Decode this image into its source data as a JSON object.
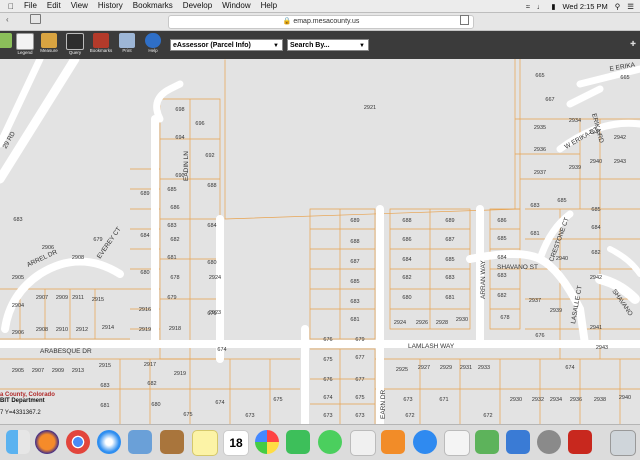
{
  "menubar": {
    "items": [
      "File",
      "Edit",
      "View",
      "History",
      "Bookmarks",
      "Develop",
      "Window",
      "Help"
    ],
    "time": "Wed 2:15 PM"
  },
  "browser": {
    "url": "emap.mesacounty.us"
  },
  "app": {
    "tools": [
      {
        "label": "Legend",
        "icon": "legend-icon"
      },
      {
        "label": "Measure",
        "icon": "measure-icon"
      },
      {
        "label": "Query",
        "icon": "query-icon"
      },
      {
        "label": "Bookmarks",
        "icon": "bookmarks-icon"
      },
      {
        "label": "Print",
        "icon": "print-icon"
      },
      {
        "label": "Help",
        "icon": "help-icon"
      }
    ],
    "layer_select": "eAssessor (Parcel Info)",
    "search_select": "Search By..."
  },
  "map": {
    "streets": [
      "W ERIKA CT",
      "ERIKA RD",
      "E ERIKA",
      "EADIN LN",
      "ARREL DR",
      "EVEREY CT",
      "ARABESQUE DR",
      "ARRAN WAY",
      "SHAVANO ST",
      "CRESTONE CT",
      "LASALLE CT",
      "LAMLASH WAY",
      "EARN DR",
      "29 RD",
      "SHAVANO"
    ],
    "parcels": [
      "698",
      "696",
      "694",
      "692",
      "690",
      "688",
      "686",
      "684",
      "682",
      "680",
      "678",
      "676",
      "674",
      "697",
      "695",
      "693",
      "691",
      "689",
      "687",
      "685",
      "683",
      "681",
      "679",
      "677",
      "675",
      "673",
      "671",
      "669",
      "667",
      "665",
      "663",
      "661",
      "659",
      "657",
      "655",
      "653",
      "651",
      "2921",
      "2935",
      "2938",
      "2937",
      "2931",
      "2943",
      "2942",
      "2941",
      "2940",
      "2939",
      "2938",
      "2937",
      "2936",
      "2906",
      "2908",
      "2907",
      "2909",
      "2911",
      "2913",
      "2915",
      "2917",
      "2919",
      "2916",
      "2918",
      "2914",
      "2912",
      "2910",
      "2923",
      "2924",
      "2925",
      "2926",
      "2927",
      "2928",
      "2929",
      "2930",
      "2932",
      "2934",
      "2936"
    ]
  },
  "infobar": {
    "county": "a County, Colorado",
    "dept": "BIT Department",
    "coord": "7 Y=4331367.2"
  },
  "dock": {
    "apps": [
      "finder-icon",
      "firefox-icon",
      "chrome-icon",
      "safari-icon",
      "preview-icon",
      "notes-icon",
      "calendar-icon",
      "photos-icon",
      "facetime-icon",
      "messages-icon",
      "books-icon",
      "appstore-icon",
      "textedit-icon",
      "numbers-icon",
      "keynote-icon",
      "preferences-icon",
      "acrobat-icon",
      "trash-icon"
    ],
    "calendar_day": "18"
  }
}
